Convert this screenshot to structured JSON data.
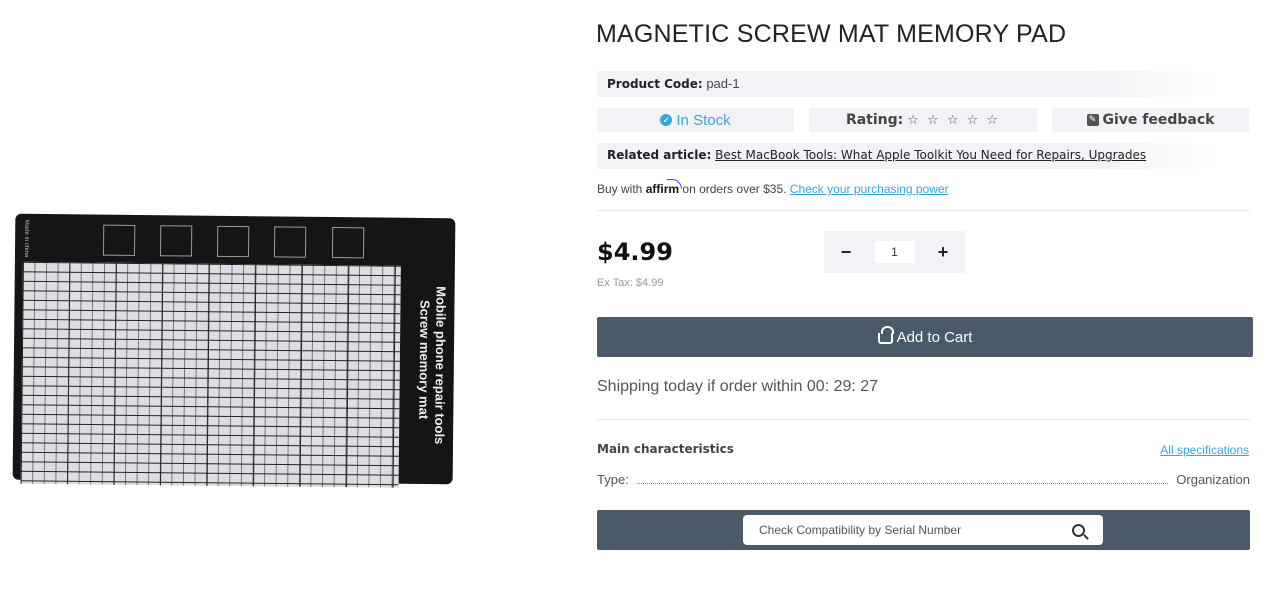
{
  "product": {
    "title": "MAGNETIC SCREW MAT MEMORY PAD",
    "code_label": "Product Code:",
    "code_value": "pad-1",
    "stock": "In Stock",
    "rating_label": "Rating:",
    "rating_stars": "☆ ☆ ☆ ☆ ☆",
    "rating_value": 0,
    "rating_max": 5,
    "feedback": "Give feedback",
    "related_label": "Related article:",
    "related_link": "Best MacBook Tools: What Apple Toolkit You Need for Repairs, Upgrades",
    "affirm_prefix": "Buy with",
    "affirm_logo": "affirm",
    "affirm_suffix": "on orders over $35.",
    "affirm_link": "Check your purchasing power",
    "price": "$4.99",
    "ex_tax": "Ex Tax: $4.99",
    "quantity": "1",
    "qty_minus": "−",
    "qty_plus": "+",
    "add_to_cart": "Add to Cart",
    "shipping_text": "Shipping today if order within",
    "shipping_timer": "00: 29: 27"
  },
  "image": {
    "mat_text_line1": "Mobile phone repair tools",
    "mat_text_line2": "Screw memory mat",
    "mat_small_text": "Made in china"
  },
  "characteristics": {
    "heading": "Main characteristics",
    "all_specs": "All specifications",
    "rows": [
      {
        "label": "Type:",
        "value": "Organization"
      }
    ]
  },
  "compat": {
    "placeholder": "Check Compatibility by Serial Number"
  },
  "colors": {
    "accent": "#3aa6d8",
    "button": "#4a5a69",
    "panel": "#f1f3f6"
  },
  "icons": [
    "check-circle-icon",
    "star-icon",
    "pencil-icon",
    "basket-icon",
    "search-icon"
  ]
}
